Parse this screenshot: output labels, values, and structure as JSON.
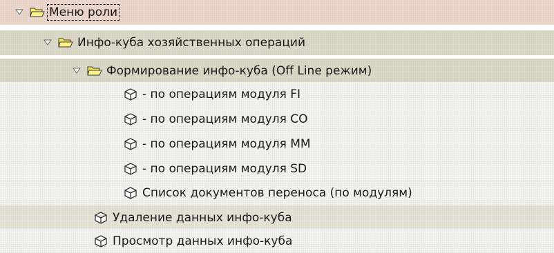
{
  "tree": {
    "root": {
      "label": "Меню роли",
      "expanded": true,
      "icon": "folder-open-icon",
      "focused": true
    },
    "group": {
      "label": "Инфо-куба хозяйственных операций",
      "expanded": true,
      "icon": "folder-open-icon"
    },
    "subgroup": {
      "label": "Формирование инфо-куба (Off Line режим)",
      "expanded": true,
      "icon": "folder-open-icon"
    },
    "subgroup_items": [
      {
        "label": "- по операциям модуля FI",
        "icon": "cube-icon"
      },
      {
        "label": "- по операциям модуля CO",
        "icon": "cube-icon"
      },
      {
        "label": "- по операциям модуля MM",
        "icon": "cube-icon"
      },
      {
        "label": "- по операциям модуля SD",
        "icon": "cube-icon"
      },
      {
        "label": "Список документов переноса (по модулям)",
        "icon": "cube-icon"
      }
    ],
    "group_items": [
      {
        "label": "Удаление данных инфо-куба",
        "icon": "cube-icon"
      },
      {
        "label": "Просмотр данных инфо-куба",
        "icon": "cube-icon"
      }
    ]
  },
  "colors": {
    "folder_fill": "#f7ea5c",
    "folder_stroke": "#3a3a3a",
    "row_root": "#ecd7cc",
    "row_group": "#dcd9c8"
  }
}
